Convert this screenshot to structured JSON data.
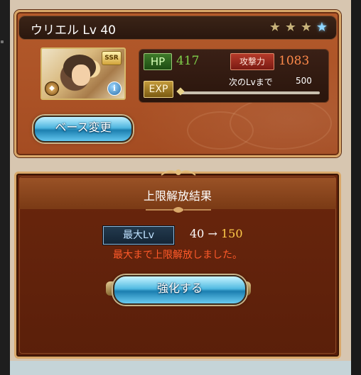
{
  "character": {
    "name": "ウリエル Lv 40",
    "rarity_badge": "SSR",
    "stars": [
      "star-gold",
      "star-gold",
      "star-gold",
      "star-blue"
    ]
  },
  "stats": {
    "hp_label": "HP",
    "hp_value": "417",
    "atk_label": "攻撃力",
    "atk_value": "1083",
    "exp_label": "EXP",
    "next_lv_label": "次のLvまで",
    "next_lv_value": "500"
  },
  "buttons": {
    "change_base": "ベース変更",
    "enhance": "強化する"
  },
  "result": {
    "title": "上限解放結果",
    "max_lv_label": "最大Lv",
    "lv_from": "40",
    "arrow": "→",
    "lv_to": "150",
    "message": "最大まで上限解放しました。"
  },
  "colors": {
    "hp": "#7fd04a",
    "atk": "#ff8a4a",
    "lv_to": "#ffcc4a",
    "message": "#ff5a2a",
    "accent_blue": "#4fb6df"
  }
}
